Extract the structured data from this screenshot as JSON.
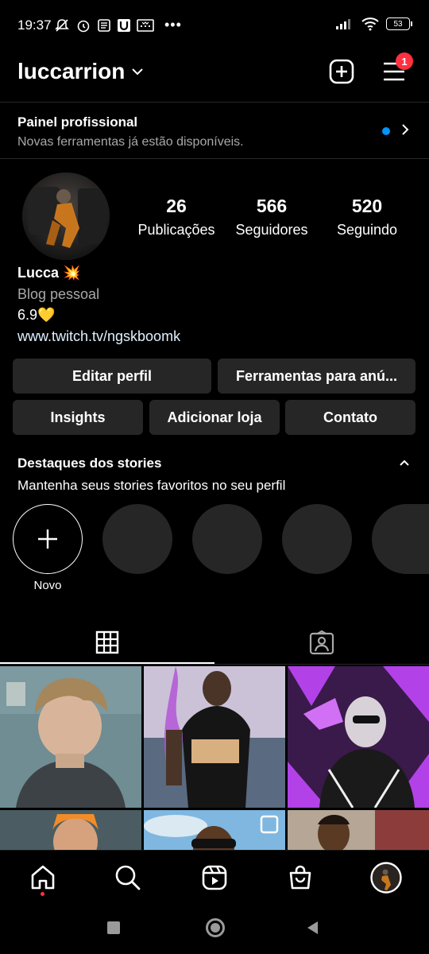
{
  "status_bar": {
    "time": "19:37",
    "battery": "53"
  },
  "header": {
    "username": "luccarrion",
    "notification_count": "1"
  },
  "pro_panel": {
    "title": "Painel profissional",
    "subtitle": "Novas ferramentas já estão disponíveis."
  },
  "profile": {
    "stats": [
      {
        "value": "26",
        "label": "Publicações"
      },
      {
        "value": "566",
        "label": "Seguidores"
      },
      {
        "value": "520",
        "label": "Seguindo"
      }
    ],
    "name": "Lucca 💥",
    "category": "Blog pessoal",
    "bio_line": "6.9💛",
    "link": "www.twitch.tv/ngskboomk"
  },
  "buttons": {
    "edit_profile": "Editar perfil",
    "ad_tools": "Ferramentas para anú...",
    "insights": "Insights",
    "add_shop": "Adicionar loja",
    "contact": "Contato"
  },
  "highlights": {
    "title": "Destaques dos stories",
    "subtitle": "Mantenha seus stories favoritos no seu perfil",
    "new_label": "Novo"
  },
  "colors": {
    "background": "#000000",
    "button": "#262626",
    "badge": "#ff3040",
    "accent_blue": "#0095f6"
  },
  "icons": {
    "create": "plus-square-icon",
    "menu": "hamburger-menu-icon",
    "grid_tab": "grid-icon",
    "tagged_tab": "tagged-person-icon",
    "nav": [
      "home-icon",
      "search-icon",
      "reels-icon",
      "shop-icon",
      "profile-avatar"
    ]
  }
}
